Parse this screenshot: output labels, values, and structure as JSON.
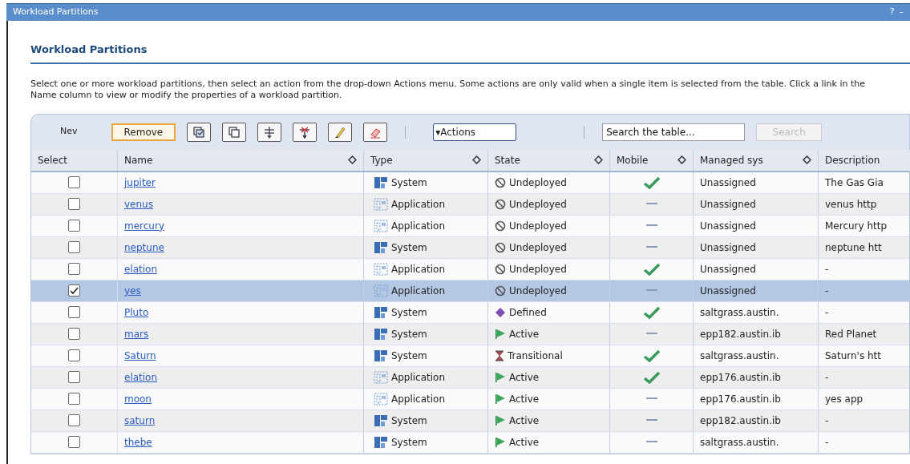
{
  "window": {
    "title": "Workload Partitions",
    "help": "?",
    "minimize": "–"
  },
  "heading": "Workload Partitions",
  "intro": "Select one or more workload partitions, then select an action from the drop-down Actions menu. Some actions are only valid when a single item is selected from the table. Click a link in the Name column to view or modify the properties of a workload partition.",
  "toolbar": {
    "new": "Nev",
    "remove": "Remove",
    "icons": [
      {
        "kind": "select-all"
      },
      {
        "kind": "deselect-all"
      },
      {
        "kind": "filter"
      },
      {
        "kind": "clear-filter"
      },
      {
        "kind": "edit"
      },
      {
        "kind": "erase"
      }
    ],
    "actions": "▾Actions",
    "search": {
      "placeholder": "Search the table..."
    },
    "search_button": "Search"
  },
  "table": {
    "columns": [
      {
        "label": "Select",
        "sortable": false
      },
      {
        "label": "Name",
        "sortable": true
      },
      {
        "label": "Type",
        "sortable": true
      },
      {
        "label": "State",
        "sortable": true
      },
      {
        "label": "Mobile",
        "sortable": true
      },
      {
        "label": "Managed sys",
        "sortable": true
      },
      {
        "label": "Description",
        "sortable": false
      }
    ],
    "rows": [
      {
        "checked": false,
        "selected": false,
        "name": "jupiter",
        "type": {
          "kind": "system",
          "label": "System"
        },
        "state": {
          "kind": "undeployed",
          "label": "Undeployed"
        },
        "mobile": true,
        "managed": "Unassigned",
        "description": "The Gas Gia"
      },
      {
        "checked": false,
        "selected": false,
        "name": "venus",
        "type": {
          "kind": "application",
          "label": "Application"
        },
        "state": {
          "kind": "undeployed",
          "label": "Undeployed"
        },
        "mobile": false,
        "managed": "Unassigned",
        "description": "venus http"
      },
      {
        "checked": false,
        "selected": false,
        "name": "mercury",
        "type": {
          "kind": "application",
          "label": "Application"
        },
        "state": {
          "kind": "undeployed",
          "label": "Undeployed"
        },
        "mobile": false,
        "managed": "Unassigned",
        "description": "Mercury http"
      },
      {
        "checked": false,
        "selected": false,
        "name": "neptune",
        "type": {
          "kind": "system",
          "label": "System"
        },
        "state": {
          "kind": "undeployed",
          "label": "Undeployed"
        },
        "mobile": false,
        "managed": "Unassigned",
        "description": "neptune htt"
      },
      {
        "checked": false,
        "selected": false,
        "name": "elation",
        "type": {
          "kind": "application",
          "label": "Application"
        },
        "state": {
          "kind": "undeployed",
          "label": "Undeployed"
        },
        "mobile": true,
        "managed": "Unassigned",
        "description": "-"
      },
      {
        "checked": true,
        "selected": true,
        "name": "yes",
        "type": {
          "kind": "application",
          "label": "Application"
        },
        "state": {
          "kind": "undeployed",
          "label": "Undeployed"
        },
        "mobile": false,
        "managed": "Unassigned",
        "description": "-"
      },
      {
        "checked": false,
        "selected": false,
        "name": "Pluto",
        "type": {
          "kind": "system",
          "label": "System"
        },
        "state": {
          "kind": "defined",
          "label": "Defined"
        },
        "mobile": true,
        "managed": "saltgrass.austin.",
        "description": "-"
      },
      {
        "checked": false,
        "selected": false,
        "name": "mars",
        "type": {
          "kind": "system",
          "label": "System"
        },
        "state": {
          "kind": "active",
          "label": "Active"
        },
        "mobile": false,
        "managed": "epp182.austin.ib",
        "description": "Red Planet"
      },
      {
        "checked": false,
        "selected": false,
        "name": "Saturn",
        "type": {
          "kind": "system",
          "label": "System"
        },
        "state": {
          "kind": "transitional",
          "label": "Transitional"
        },
        "mobile": true,
        "managed": "saltgrass.austin.",
        "description": "Saturn's htt"
      },
      {
        "checked": false,
        "selected": false,
        "name": "elation",
        "type": {
          "kind": "application",
          "label": "Application"
        },
        "state": {
          "kind": "active",
          "label": "Active"
        },
        "mobile": true,
        "managed": "epp176.austin.ib",
        "description": "-"
      },
      {
        "checked": false,
        "selected": false,
        "name": "moon",
        "type": {
          "kind": "application",
          "label": "Application"
        },
        "state": {
          "kind": "active",
          "label": "Active"
        },
        "mobile": false,
        "managed": "epp176.austin.ib",
        "description": "yes app"
      },
      {
        "checked": false,
        "selected": false,
        "name": "saturn",
        "type": {
          "kind": "system",
          "label": "System"
        },
        "state": {
          "kind": "active",
          "label": "Active"
        },
        "mobile": false,
        "managed": "epp182.austin.ib",
        "description": "-"
      },
      {
        "checked": false,
        "selected": false,
        "name": "thebe",
        "type": {
          "kind": "system",
          "label": "System"
        },
        "state": {
          "kind": "active",
          "label": "Active"
        },
        "mobile": false,
        "managed": "saltgrass.austin.",
        "description": "-"
      }
    ]
  }
}
